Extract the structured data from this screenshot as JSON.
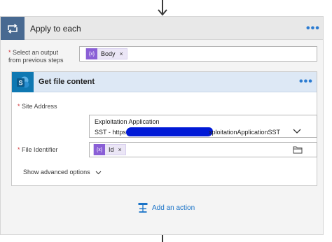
{
  "outer_action": {
    "title": "Apply to each",
    "more": "•••"
  },
  "select_output": {
    "label_line1": "Select an output",
    "label_line2": "from previous steps",
    "token": {
      "icon": "{x}",
      "text": "Body",
      "remove": "×"
    }
  },
  "inner_action": {
    "title": "Get file content",
    "more": "•••",
    "site_address": {
      "label": "Site Address",
      "name": "Exploitation Application",
      "url_start": "SST - https://",
      "url_end": "xploitationApplicationSST"
    },
    "file_identifier": {
      "label": "File Identifier",
      "token": {
        "icon": "{x}",
        "text": "Id",
        "remove": "×"
      }
    },
    "show_advanced": "Show advanced options"
  },
  "add_action": {
    "label": "Add an action"
  },
  "colors": {
    "loop_icon": "#486991",
    "sharepoint_icon": "#0f78b2",
    "token_icon": "#8a5fd6",
    "accent": "#2b7bd1",
    "redaction": "#0019d6"
  },
  "icons": [
    "down-arrow-icon",
    "loop-icon",
    "sharepoint-icon",
    "expression-token-icon",
    "chevron-down-icon",
    "folder-icon",
    "add-action-icon"
  ]
}
